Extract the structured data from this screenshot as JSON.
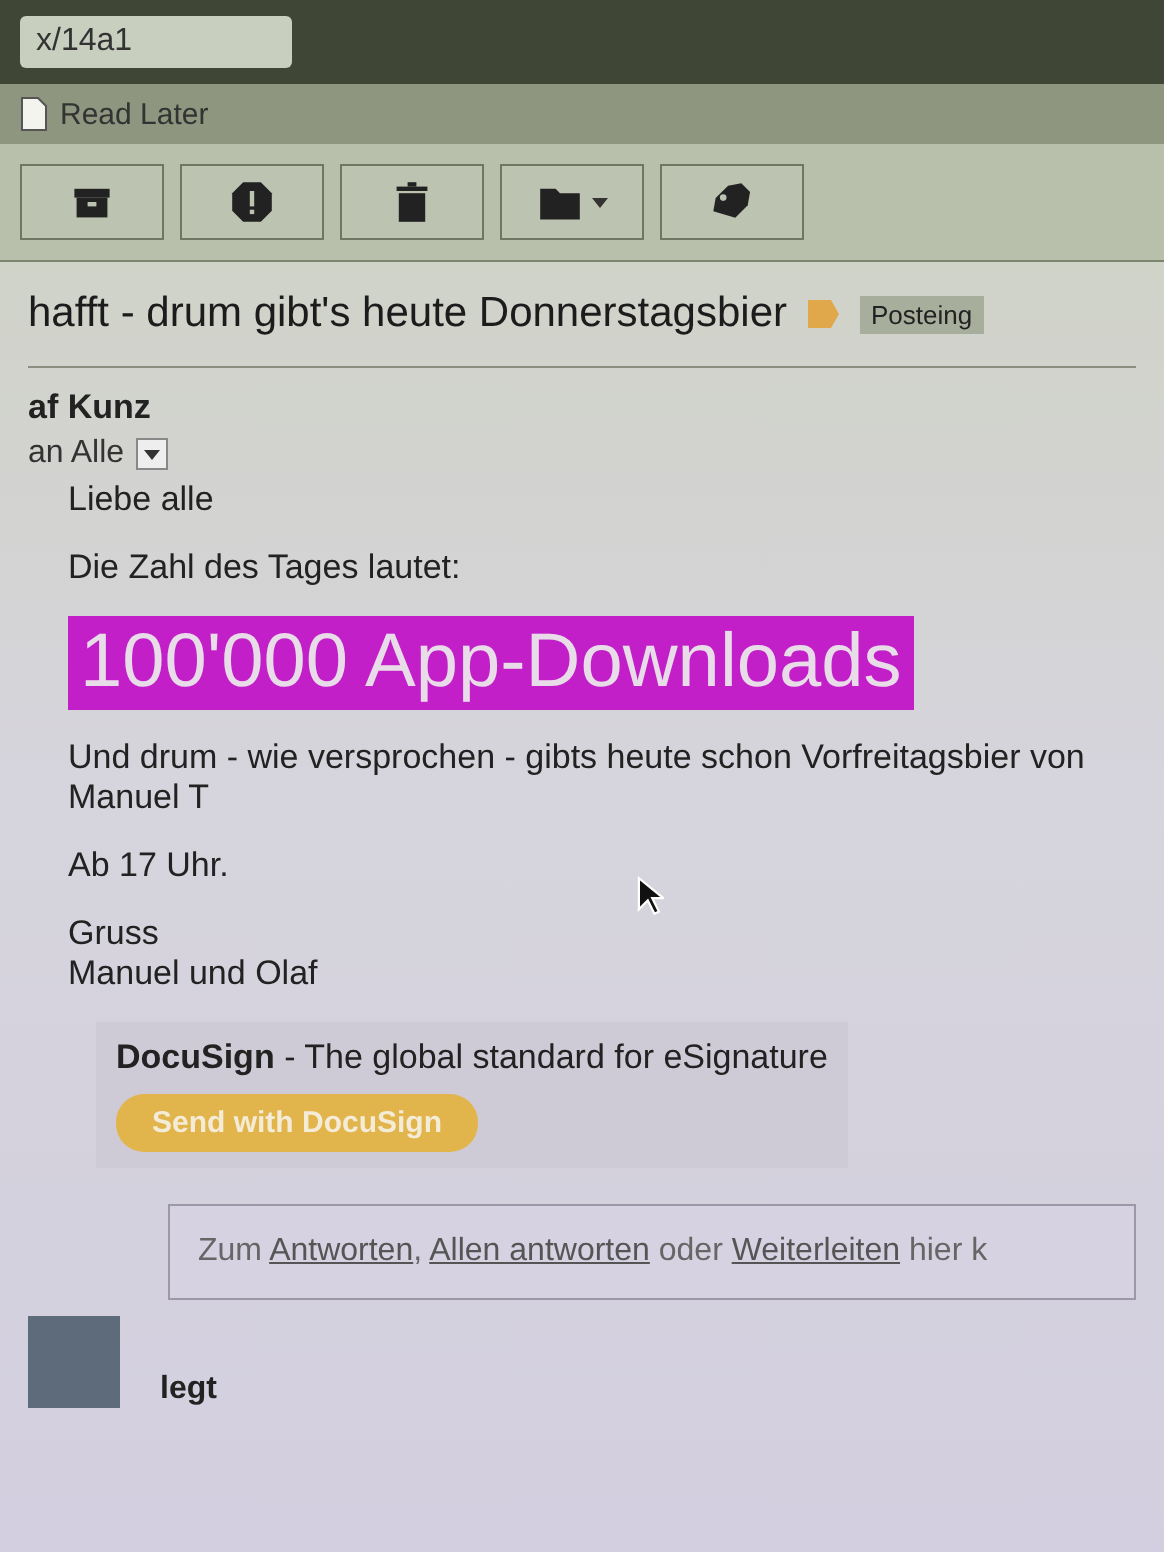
{
  "address_bar": {
    "text": "x/14a1"
  },
  "bookmarks": [
    {
      "label": "Read Later"
    }
  ],
  "toolbar": {
    "buttons": [
      {
        "kind": "archive",
        "dropdown": false
      },
      {
        "kind": "spam",
        "dropdown": false
      },
      {
        "kind": "delete",
        "dropdown": false
      },
      {
        "kind": "move",
        "dropdown": true
      },
      {
        "kind": "label",
        "dropdown": false
      }
    ]
  },
  "subject": {
    "text": "hafft - drum gibt's heute Donnerstagsbier",
    "important": true,
    "label_chip": "Posteing"
  },
  "sender": {
    "name": "af Kunz",
    "recipients": "an Alle"
  },
  "body": [
    {
      "kind": "text",
      "text": "Liebe alle"
    },
    {
      "kind": "text",
      "text": "Die Zahl des Tages lautet:"
    },
    {
      "kind": "highlight",
      "text": "100'000 App-Downloads"
    },
    {
      "kind": "text",
      "text": "Und drum - wie versprochen - gibts heute schon Vorfreitagsbier von Manuel T"
    },
    {
      "kind": "text",
      "text": "Ab 17 Uhr."
    },
    {
      "kind": "lines",
      "lines": [
        "Gruss",
        "Manuel und Olaf"
      ]
    }
  ],
  "docusign": {
    "tagline": "**DocuSign** - The global standard for eSignature",
    "button": "Send with DocuSign"
  },
  "reply": {
    "parts": [
      {
        "kind": "text",
        "text": "Zum "
      },
      {
        "kind": "link",
        "text": "Antworten"
      },
      {
        "kind": "text",
        "text": ", "
      },
      {
        "kind": "link",
        "text": "Allen antworten"
      },
      {
        "kind": "text",
        "text": " oder "
      },
      {
        "kind": "link",
        "text": "Weiterleiten"
      },
      {
        "kind": "text",
        "text": " hier k"
      }
    ]
  },
  "footer": {
    "text": "legt"
  }
}
